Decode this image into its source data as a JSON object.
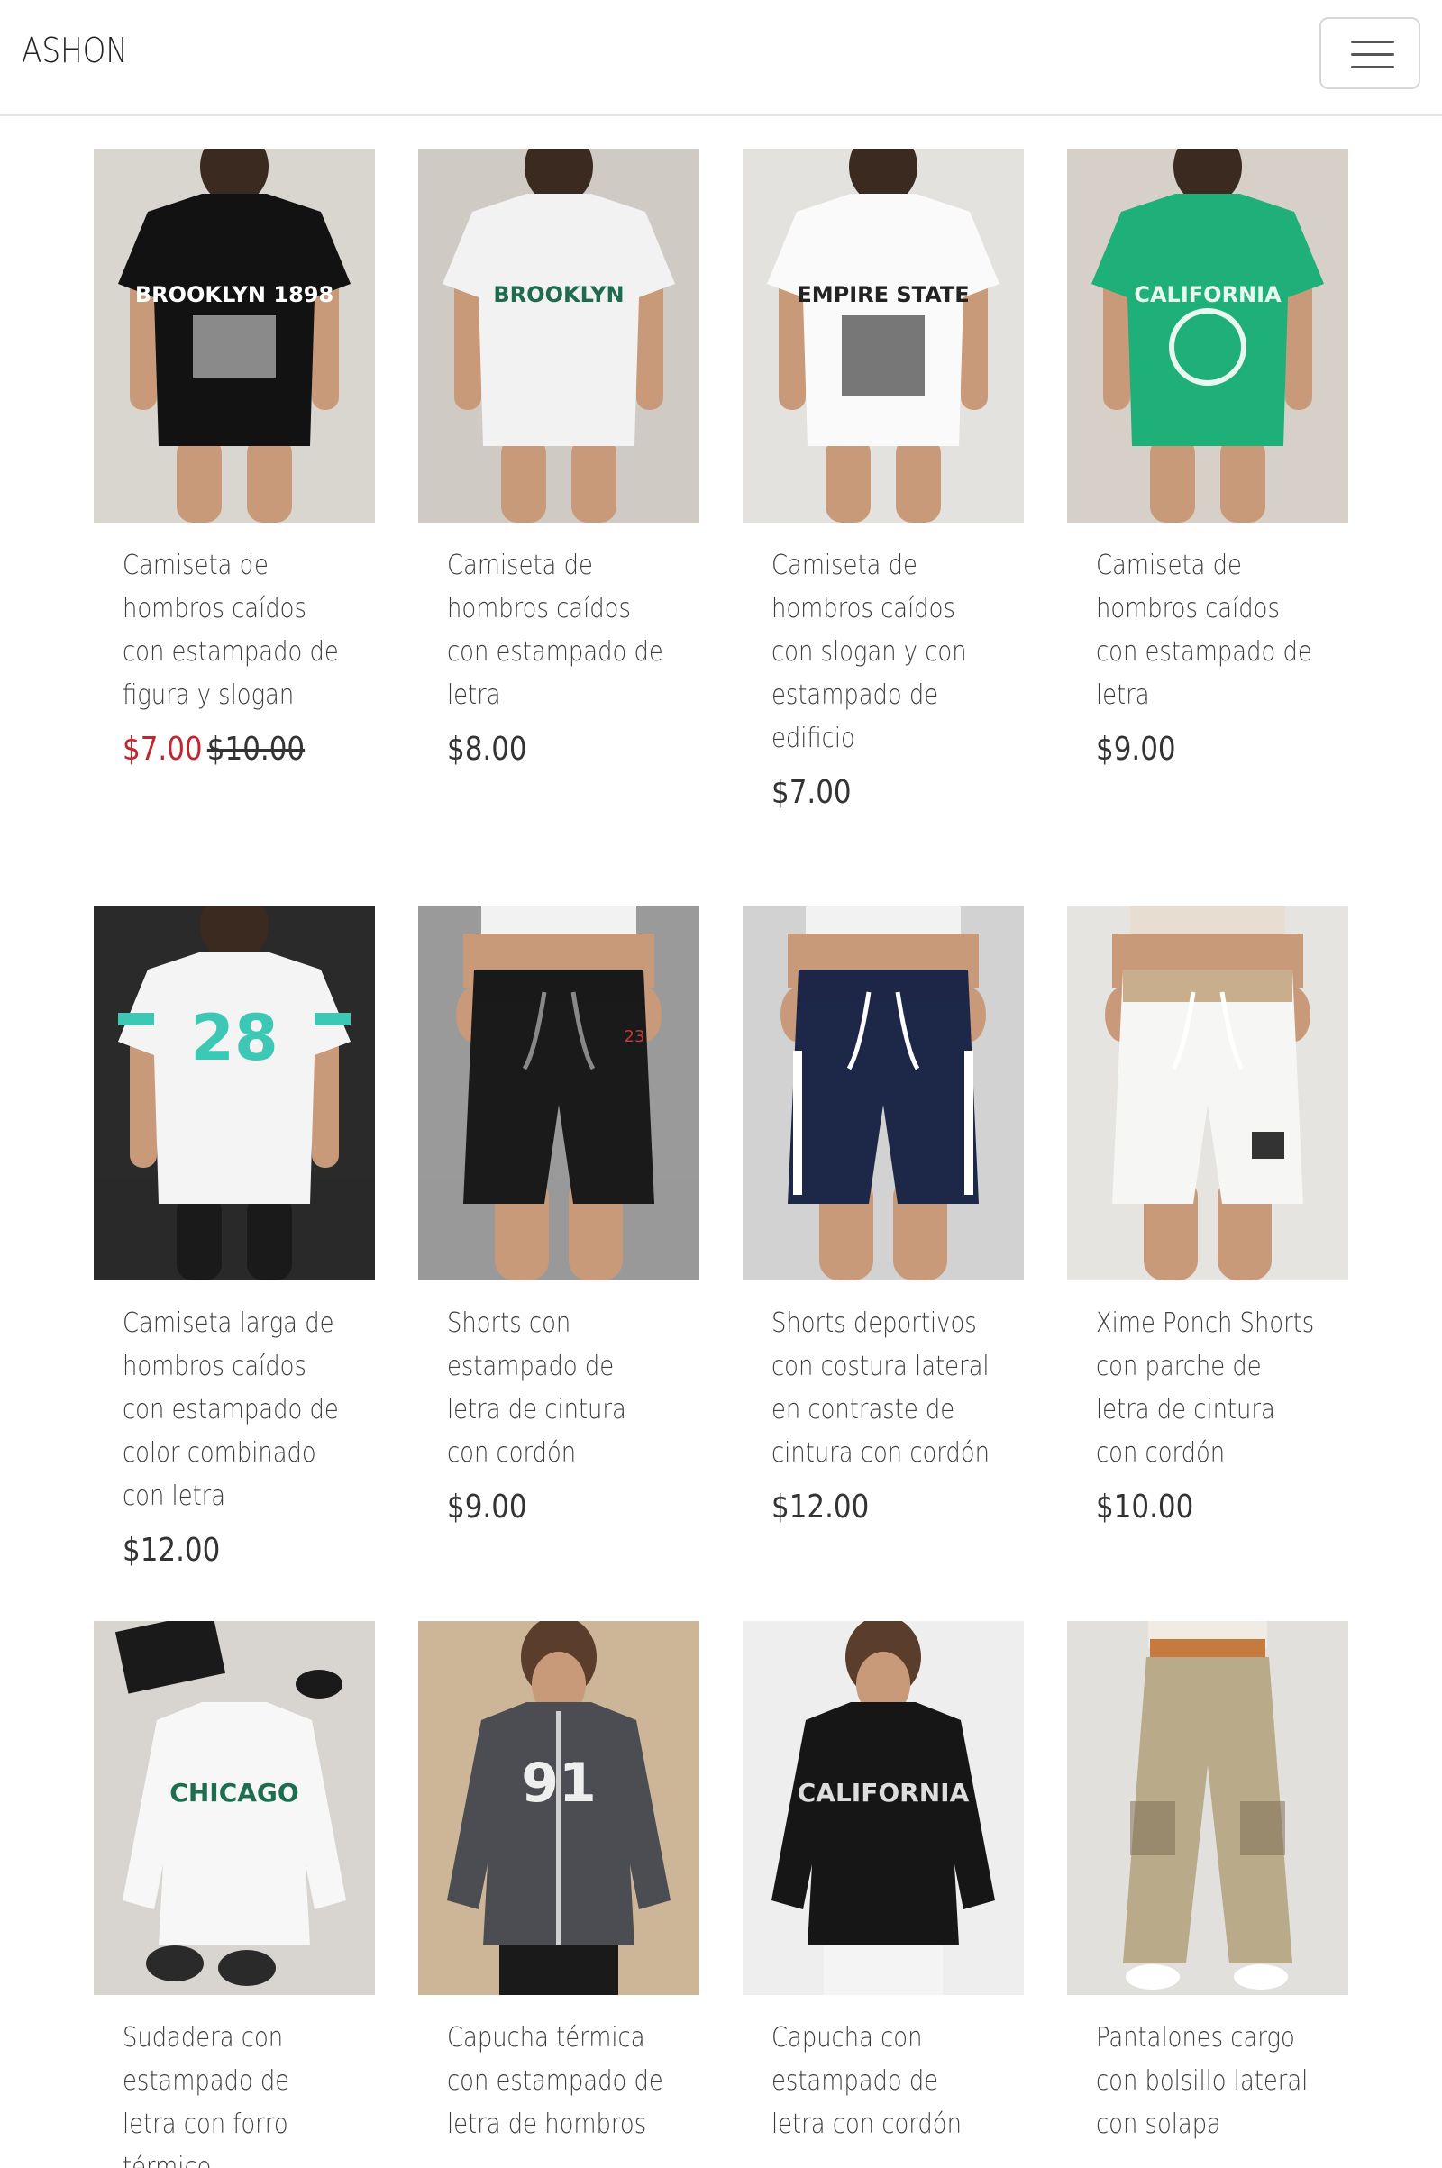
{
  "navbar": {
    "brand": "ASHON",
    "toggler_icon": "hamburger-menu-icon"
  },
  "products": [
    {
      "title": "Camiseta de hombros caídos con estampado de figura y slogan",
      "price": "$7.00",
      "old_price": "$10.00",
      "on_sale": true,
      "image_colors": {
        "bg": "#d9d5cf",
        "item": "#121212",
        "accent": "#ffffff"
      },
      "print_text": "BROOKLYN 1898"
    },
    {
      "title": "Camiseta de hombros caídos con estampado de letra",
      "price": "$8.00",
      "old_price": "",
      "on_sale": false,
      "image_colors": {
        "bg": "#cfcac4",
        "item": "#f2f2f2",
        "accent": "#1f6b4e"
      },
      "print_text": "BROOKLYN"
    },
    {
      "title": "Camiseta de hombros caídos con slogan y con estampado de edificio",
      "price": "$7.00",
      "old_price": "",
      "on_sale": false,
      "image_colors": {
        "bg": "#e4e2df",
        "item": "#fafafa",
        "accent": "#222222"
      },
      "print_text": "EMPIRE STATE"
    },
    {
      "title": "Camiseta de hombros caídos con estampado de letra",
      "price": "$9.00",
      "old_price": "",
      "on_sale": false,
      "image_colors": {
        "bg": "#d6d0c8",
        "item": "#1fb07a",
        "accent": "#e8f7ef"
      },
      "print_text": "CALIFORNIA"
    },
    {
      "title": "Camiseta larga de hombros caídos con estampado de color combinado con letra",
      "price": "$12.00",
      "old_price": "",
      "on_sale": false,
      "image_colors": {
        "bg": "#2a2a2a",
        "item": "#f4f4f4",
        "accent": "#3cc8b4"
      },
      "print_text": "28"
    },
    {
      "title": "Shorts con estampado de letra de cintura con cordón",
      "price": "$9.00",
      "old_price": "",
      "on_sale": false,
      "image_colors": {
        "bg": "#9a9a9a",
        "item": "#1a1a1a",
        "accent": "#c23a3a"
      },
      "print_text": "23"
    },
    {
      "title": "Shorts deportivos con costura lateral en contraste de cintura con cordón",
      "price": "$12.00",
      "old_price": "",
      "on_sale": false,
      "image_colors": {
        "bg": "#d2d2d2",
        "item": "#1d2748",
        "accent": "#ffffff"
      },
      "print_text": ""
    },
    {
      "title": "Xime Ponch Shorts con parche de letra de cintura con cordón",
      "price": "$10.00",
      "old_price": "",
      "on_sale": false,
      "image_colors": {
        "bg": "#e6e4e1",
        "item": "#f6f6f4",
        "accent": "#c9ae8e"
      },
      "print_text": ""
    },
    {
      "title": "Sudadera con estampado de letra con forro térmico",
      "price": "",
      "old_price": "",
      "on_sale": false,
      "image_colors": {
        "bg": "#d8d5d1",
        "item": "#f7f7f7",
        "accent": "#1d6e4f"
      },
      "print_text": "CHICAGO"
    },
    {
      "title": "Capucha térmica con estampado de letra de hombros",
      "price": "",
      "old_price": "",
      "on_sale": false,
      "image_colors": {
        "bg": "#cdb597",
        "item": "#4b4d52",
        "accent": "#eeeeee"
      },
      "print_text": "91"
    },
    {
      "title": "Capucha con estampado de letra con cordón",
      "price": "",
      "old_price": "",
      "on_sale": false,
      "image_colors": {
        "bg": "#eeeeee",
        "item": "#161616",
        "accent": "#dddddd"
      },
      "print_text": "CALIFORNIA"
    },
    {
      "title": "Pantalones cargo con bolsillo lateral con solapa",
      "price": "",
      "old_price": "",
      "on_sale": false,
      "image_colors": {
        "bg": "#e2e0dd",
        "item": "#b9aa8a",
        "accent": "#7a6a4f"
      },
      "print_text": ""
    }
  ],
  "colors": {
    "sale_price": "#c0262d",
    "text": "#3d3d3d",
    "navbar_border": "#e3e3e3"
  }
}
